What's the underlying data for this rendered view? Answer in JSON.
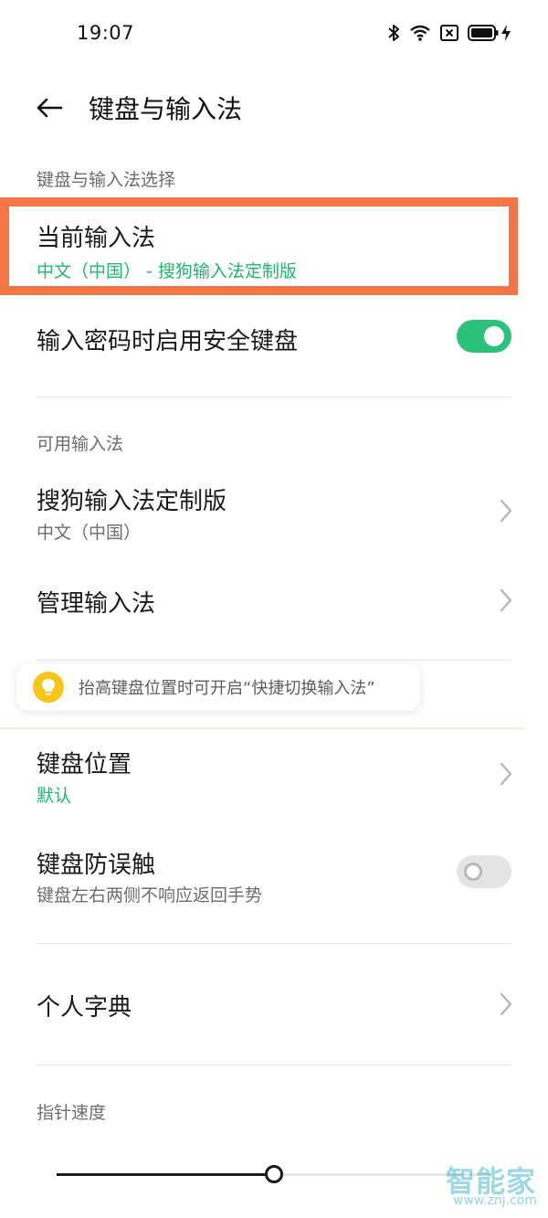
{
  "status_bar": {
    "time": "19:07",
    "icons": [
      "bluetooth-icon",
      "wifi-icon",
      "sim-off-icon",
      "battery-icon",
      "charging-icon"
    ]
  },
  "header": {
    "title": "键盘与输入法"
  },
  "sections": {
    "selection": {
      "label": "键盘与输入法选择",
      "current_ime": {
        "title": "当前输入法",
        "subtitle": "中文（中国） - 搜狗输入法定制版"
      },
      "secure_keyboard": {
        "title": "输入密码时启用安全键盘",
        "enabled": true
      }
    },
    "available": {
      "label": "可用输入法",
      "sogou": {
        "title": "搜狗输入法定制版",
        "subtitle": "中文（中国）"
      },
      "manage": {
        "title": "管理输入法"
      }
    },
    "tip": {
      "text": "抬高键盘位置时可开启“快捷切换输入法”"
    },
    "keyboard_position": {
      "title": "键盘位置",
      "subtitle": "默认"
    },
    "anti_mistouch": {
      "title": "键盘防误触",
      "subtitle": "键盘左右两侧不响应返回手势",
      "enabled": false
    },
    "dictionary": {
      "title": "个人字典"
    },
    "pointer_speed": {
      "label": "指针速度",
      "value": 0.5
    }
  },
  "watermark": {
    "logo": "智能家",
    "url": "www.znj.com"
  },
  "colors": {
    "accent_green": "#1fb86e",
    "toggle_on": "#2dc27a",
    "highlight_border": "#f47646",
    "tip_icon": "#f5c518"
  }
}
